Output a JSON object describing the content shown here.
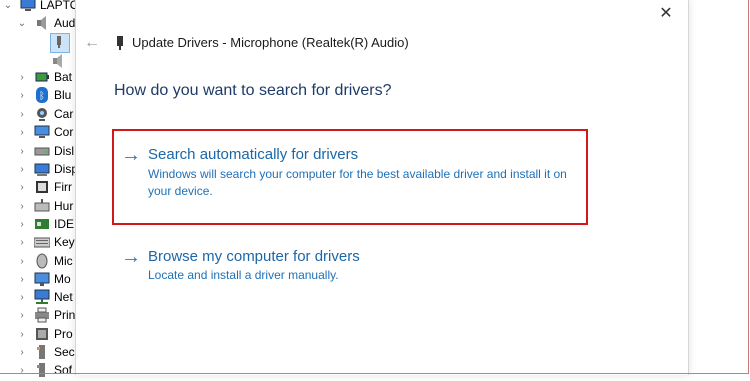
{
  "tree": {
    "root_label": "LAPTOP",
    "audio_label": "Aud",
    "items": [
      {
        "label": "Bat",
        "icon": "battery-icon"
      },
      {
        "label": "Blu",
        "icon": "bluetooth-icon"
      },
      {
        "label": "Car",
        "icon": "camera-icon"
      },
      {
        "label": "Cor",
        "icon": "computer-icon"
      },
      {
        "label": "Disl",
        "icon": "disk-drive-icon"
      },
      {
        "label": "Disp",
        "icon": "display-adapter-icon"
      },
      {
        "label": "Firr",
        "icon": "firmware-icon"
      },
      {
        "label": "Hur",
        "icon": "hid-icon"
      },
      {
        "label": "IDE",
        "icon": "ide-controller-icon"
      },
      {
        "label": "Key",
        "icon": "keyboard-icon"
      },
      {
        "label": "Mic",
        "icon": "mouse-icon"
      },
      {
        "label": "Mo",
        "icon": "monitor-icon"
      },
      {
        "label": "Net",
        "icon": "network-adapter-icon"
      },
      {
        "label": "Prin",
        "icon": "print-queue-icon"
      },
      {
        "label": "Pro",
        "icon": "processor-icon"
      },
      {
        "label": "Sec",
        "icon": "security-device-icon"
      },
      {
        "label": "Sof",
        "icon": "software-device-icon"
      }
    ]
  },
  "dialog": {
    "title": "Update Drivers - Microphone (Realtek(R) Audio)",
    "close_glyph": "✕",
    "back_glyph": "←",
    "heading": "How do you want to search for drivers?",
    "options": [
      {
        "arrow": "→",
        "title": "Search automatically for drivers",
        "description": "Windows will search your computer for the best available driver and install it on your device.",
        "highlighted": true
      },
      {
        "arrow": "→",
        "title": "Browse my computer for drivers",
        "description": "Locate and install a driver manually.",
        "highlighted": false
      }
    ]
  },
  "colors": {
    "highlight_border": "#d0191a",
    "link_blue": "#1b67a8",
    "heading_blue": "#1e3a66"
  }
}
